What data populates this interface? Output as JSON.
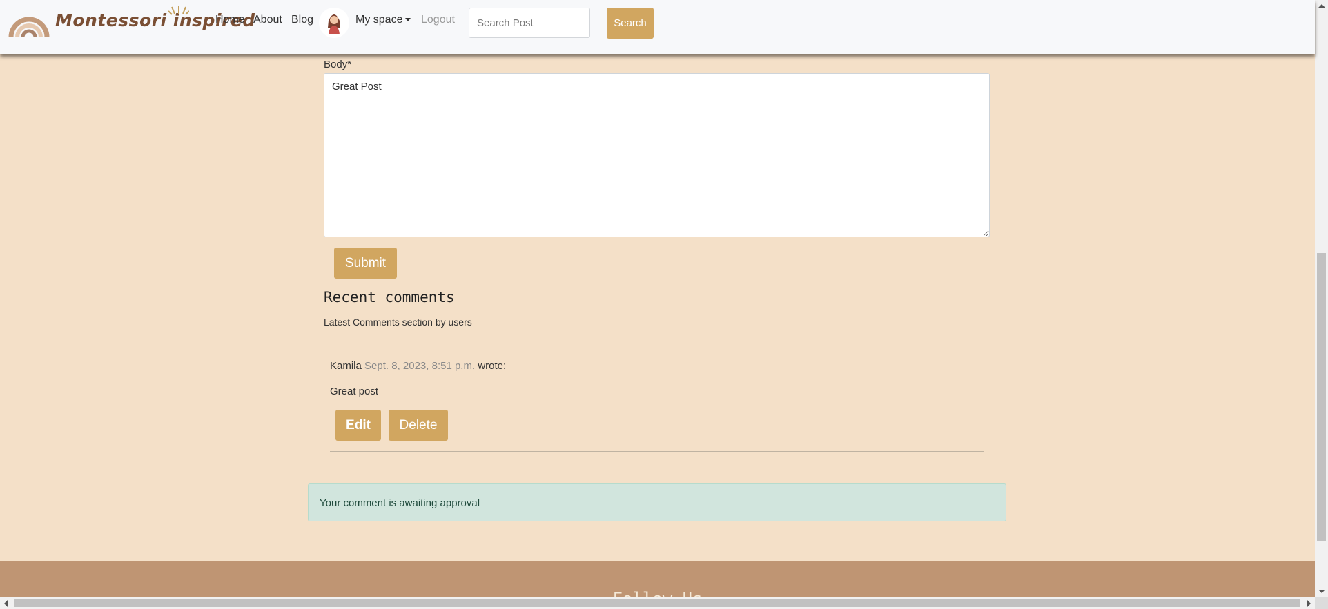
{
  "navbar": {
    "brand": "Montessori inspired",
    "links": {
      "home": "Home",
      "about": "About",
      "blog": "Blog",
      "my_space": "My space",
      "logout": "Logout"
    },
    "search": {
      "placeholder": "Search Post",
      "button": "Search"
    }
  },
  "form": {
    "body_label": "Body*",
    "body_value": "Great Post",
    "submit": "Submit"
  },
  "comments": {
    "title": "Recent comments",
    "subtitle": "Latest Comments section by users",
    "items": [
      {
        "author": "Kamila",
        "date": "Sept. 8, 2023, 8:51 p.m.",
        "wrote": "wrote:",
        "body": "Great post",
        "edit": "Edit",
        "delete": "Delete"
      }
    ]
  },
  "alert": {
    "message": "Your comment is awaiting approval"
  },
  "footer": {
    "title": "Follow Us"
  },
  "colors": {
    "page_bg": "#f4e0c8",
    "accent": "#d1a660",
    "footer_bg": "#bf9573",
    "alert_bg": "#d1e5dd"
  }
}
